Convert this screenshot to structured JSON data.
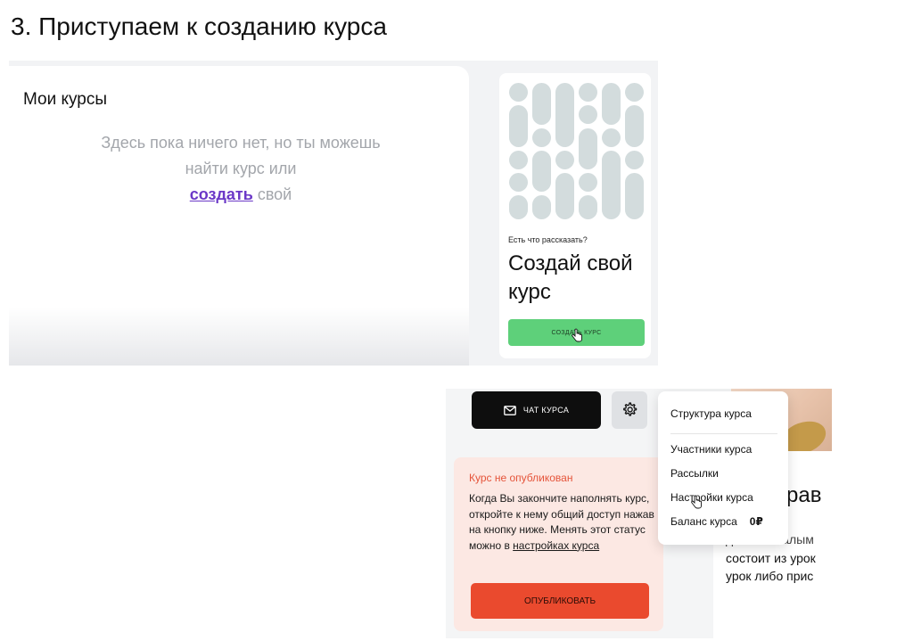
{
  "heading": "3. Приступаем к созданию курса",
  "my_courses": {
    "title": "Мои курсы",
    "empty_before": "Здесь пока ничего нет, но ты можешь найти курс или",
    "create_link": "создать",
    "empty_after": "свой"
  },
  "promo": {
    "small_text": "Есть что рассказать?",
    "big_text": "Создай свой курс",
    "button_label": "СОЗДАТЬ КУРС",
    "pattern_color": "#d3dcdd",
    "button_color": "#5ed07a"
  },
  "course_page": {
    "chat_button": "ЧАТ КУРСА",
    "chat_icon": "mail-icon",
    "settings_icon": "gear-icon",
    "status": {
      "title": "Курс не опубликован",
      "body": "Когда Вы закончите наполнять курс, откройте к нему общий доступ нажав на кнопку ниже. Менять этот статус можно в",
      "settings_link": "настройках курса",
      "publish_button": "ОПУБЛИКОВАТЬ",
      "accent_color": "#ea4a2e"
    },
    "menu": {
      "structure": "Структура курса",
      "participants": "Участники курса",
      "mailings": "Рассылки",
      "settings": "Настройки курса",
      "balance_label": "Баланс курса",
      "balance_value": "0₽"
    },
    "background": {
      "title_fragment": "рав",
      "line1": "дело за малым",
      "line2": "состоит из урок",
      "line3": "урок либо прис"
    }
  }
}
